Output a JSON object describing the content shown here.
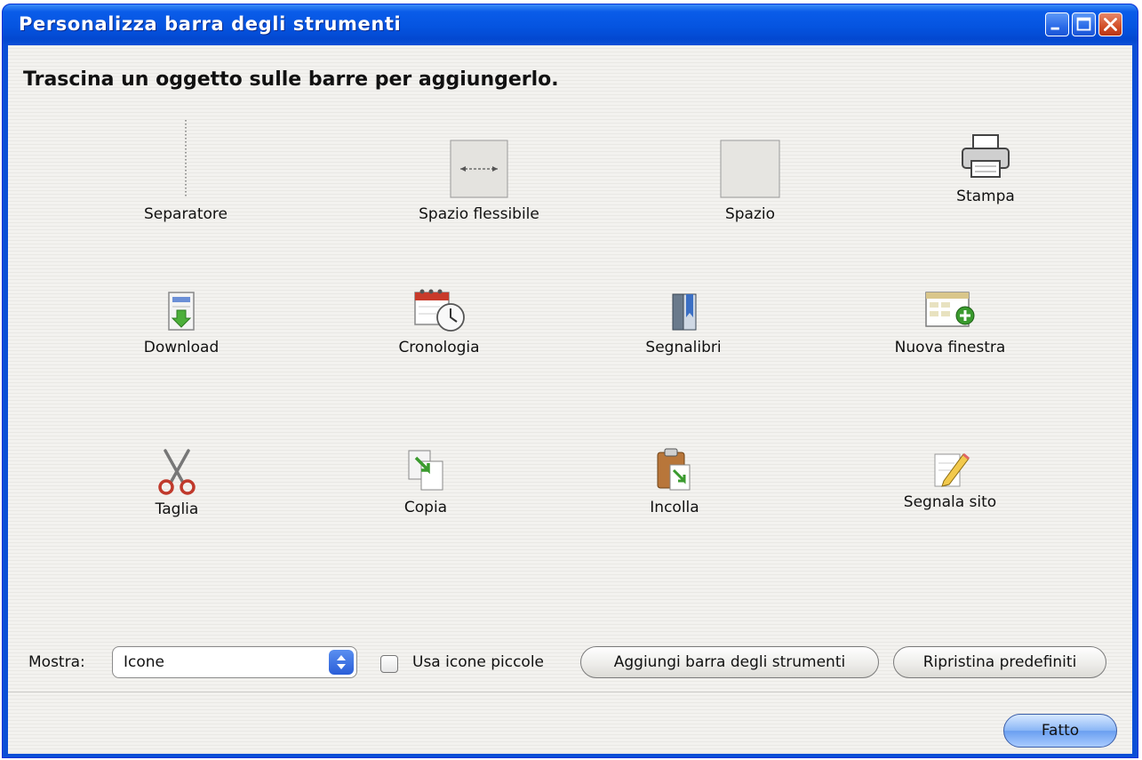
{
  "window": {
    "title": "Personalizza barra degli strumenti",
    "controls": [
      "minimize-icon",
      "maximize-icon",
      "close-icon"
    ]
  },
  "heading": "Trascina un oggetto sulle barre per aggiungerlo.",
  "items": [
    {
      "label": "Separatore",
      "icon": "separator-icon"
    },
    {
      "label": "Spazio flessibile",
      "icon": "flexible-space-icon"
    },
    {
      "label": "Spazio",
      "icon": "space-icon"
    },
    {
      "label": "Stampa",
      "icon": "printer-icon"
    },
    {
      "label": "Download",
      "icon": "download-icon"
    },
    {
      "label": "Cronologia",
      "icon": "history-icon"
    },
    {
      "label": "Segnalibri",
      "icon": "bookmarks-icon"
    },
    {
      "label": "Nuova finestra",
      "icon": "new-window-icon"
    },
    {
      "label": "Taglia",
      "icon": "scissors-icon"
    },
    {
      "label": "Copia",
      "icon": "copy-icon"
    },
    {
      "label": "Incolla",
      "icon": "paste-icon"
    },
    {
      "label": "Segnala sito",
      "icon": "report-site-icon"
    }
  ],
  "footer": {
    "show_label": "Mostra:",
    "show_value": "Icone",
    "small_icons_label": "Usa icone piccole",
    "small_icons_checked": false,
    "add_toolbar_label": "Aggiungi barra degli strumenti",
    "restore_defaults_label": "Ripristina predefiniti",
    "done_label": "Fatto"
  }
}
